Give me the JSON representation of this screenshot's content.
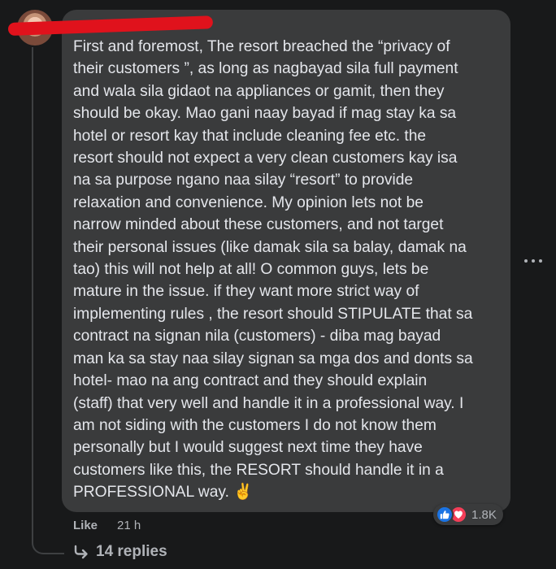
{
  "comment": {
    "text": "First and foremost, The resort breached the “privacy of\ntheir customers ”, as long as nagbayad sila full payment\nand wala sila gidaot na appliances or gamit, then they\nshould be okay. Mao gani naay bayad if mag stay ka sa\nhotel or resort kay that include cleaning fee etc. the\nresort should not expect a very clean customers kay isa\nna sa purpose ngano naa silay “resort” to provide\nrelaxation and convenience. My opinion lets not be\nnarrow minded about these customers, and not target\ntheir personal issues (like damak sila sa balay, damak na\ntao) this will not help at all! O common guys, lets be\nmature in the issue. if they want more strict way of\nimplementing rules , the resort should STIPULATE that sa\ncontract na signan nila (customers) - diba mag bayad\nman ka sa stay naa silay signan sa mga dos and donts sa\nhotel- mao na ang contract and they should explain\n(staff) that very well and handle it in a professional way. I\nam not siding with the customers I do not know them\npersonally but I would suggest next time they have\ncustomers like this, the RESORT should handle it in a\nPROFESSIONAL way. ✌️",
    "like_label": "Like",
    "timestamp": "21 h",
    "reaction_count": "1.8K",
    "reactions": [
      "like-icon",
      "love-icon"
    ],
    "replies_label": "14 replies"
  },
  "colors": {
    "background": "#18191a",
    "bubble": "#3a3b3c",
    "text": "#e4e6eb",
    "secondary_text": "#b0b3b8",
    "like_blue": "#1b74e4",
    "love_red": "#f33e58",
    "redaction": "#e0121c"
  }
}
